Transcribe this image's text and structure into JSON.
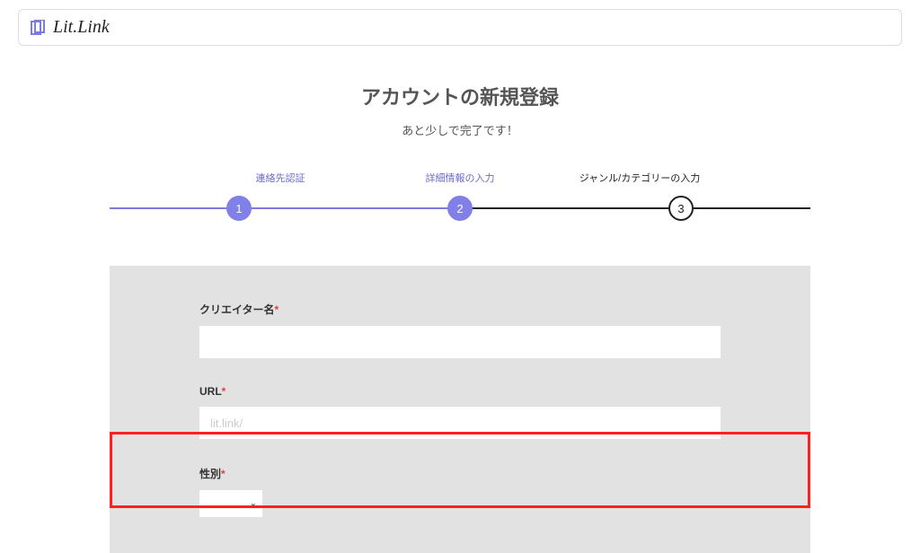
{
  "header": {
    "logo_text": "Lit.Link"
  },
  "page": {
    "title": "アカウントの新規登録",
    "subtitle": "あと少しで完了です！"
  },
  "progress": {
    "steps": [
      {
        "number": "1",
        "label": "連絡先認証",
        "active": true
      },
      {
        "number": "2",
        "label": "詳細情報の入力",
        "active": true
      },
      {
        "number": "3",
        "label": "ジャンル/カテゴリーの入力",
        "active": false
      }
    ]
  },
  "form": {
    "creator_name": {
      "label": "クリエイター名",
      "required": "*",
      "value": ""
    },
    "url": {
      "label": "URL",
      "required": "*",
      "prefix": "lit.link/",
      "value": ""
    },
    "gender": {
      "label": "性別",
      "required": "*",
      "value": ""
    }
  }
}
